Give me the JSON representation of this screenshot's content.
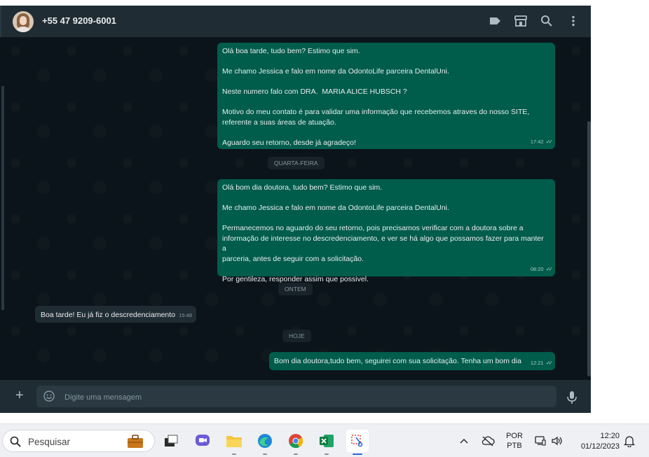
{
  "header": {
    "contact_name": "+55 47 9209-6001",
    "icons": [
      "label-icon",
      "catalog-icon",
      "search-icon",
      "menu-icon"
    ]
  },
  "messages": {
    "m1": {
      "lines": [
        "Olá boa tarde, tudo bem? Estimo que sim.",
        "",
        "Me chamo Jessica e falo em nome da OdontoLife parceira DentalUni.",
        "",
        "Neste numero falo com DRA.  MARIA ALICE HUBSCH ?",
        "",
        "Motivo do meu contato é para validar uma informação que recebemos atraves do nosso SITE,",
        "referente a suas áreas de atuação.",
        "",
        "Aguardo seu retorno, desde já agradeço!"
      ],
      "time": "17:42"
    },
    "day1": "QUARTA-FEIRA",
    "m2": {
      "lines": [
        "Olá bom dia doutora, tudo bem? Estimo que sim.",
        "",
        "Me chamo Jessica e falo em nome da OdontoLife parceira DentalUni.",
        "",
        "Permanecemos no aguardo do seu retorno, pois precisamos verificar com a doutora sobre a",
        "informação de interesse no descredenciamento, e ver se há algo que possamos fazer para manter a",
        "parceria, antes de seguir com a solicitação.",
        "",
        "Por gentileza, responder assim que possivel."
      ],
      "time": "08:20"
    },
    "day2": "ONTEM",
    "m3": {
      "text": "Boa tarde! Eu já fiz o descredenciamento",
      "time": "15:48"
    },
    "day3": "HOJE",
    "m4": {
      "text": "Bom dia doutora,tudo bem, seguirei com sua solicitação. Tenha um bom dia",
      "time": "12:21"
    }
  },
  "composer": {
    "placeholder": "Digite uma mensagem"
  },
  "taskbar": {
    "search_label": "Pesquisar",
    "apps": [
      "file-explorer",
      "teams-chat",
      "files",
      "edge",
      "chrome",
      "excel",
      "snipping-tool"
    ],
    "lang_top": "POR",
    "lang_bottom": "PTB",
    "time": "12:20",
    "date": "01/12/2023"
  },
  "colors": {
    "outgoing": "#005c4b",
    "incoming": "#202c33",
    "background": "#0b141a",
    "panel": "#202c33"
  }
}
